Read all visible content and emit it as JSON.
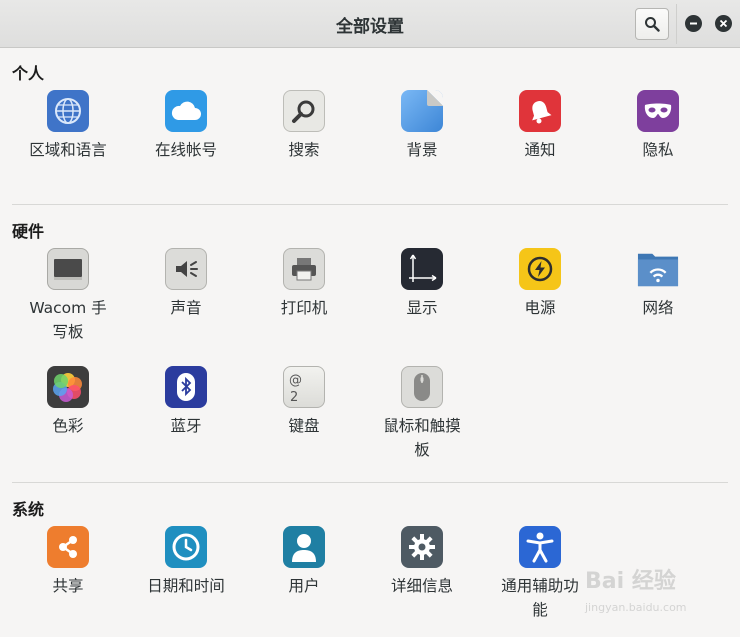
{
  "window": {
    "title": "全部设置"
  },
  "sections": {
    "personal": {
      "title": "个人",
      "items": [
        {
          "label": "区域和语言"
        },
        {
          "label": "在线帐号"
        },
        {
          "label": "搜索"
        },
        {
          "label": "背景"
        },
        {
          "label": "通知"
        },
        {
          "label": "隐私"
        }
      ]
    },
    "hardware": {
      "title": "硬件",
      "items": [
        {
          "label": "Wacom 手写板"
        },
        {
          "label": "声音"
        },
        {
          "label": "打印机"
        },
        {
          "label": "显示"
        },
        {
          "label": "电源"
        },
        {
          "label": "网络"
        },
        {
          "label": "色彩"
        },
        {
          "label": "蓝牙"
        },
        {
          "label": "键盘"
        },
        {
          "label": "鼠标和触摸板"
        }
      ]
    },
    "system": {
      "title": "系统",
      "items": [
        {
          "label": "共享"
        },
        {
          "label": "日期和时间"
        },
        {
          "label": "用户"
        },
        {
          "label": "详细信息"
        },
        {
          "label": "通用辅助功能"
        }
      ]
    }
  },
  "watermark": {
    "text": "Bai 经验",
    "sub": "jingyan.baidu.com"
  },
  "colors": {
    "region": "#3f74c8",
    "online": "#2f9ae6",
    "search": "#e8e8e4",
    "background": "#5aa0e6",
    "notifications": "#e0343a",
    "privacy": "#7e3f9d",
    "sound": "#dcdcd9",
    "power": "#f5c518",
    "network": "#5b8fc9",
    "bluetooth": "#2b3c9e",
    "sharing": "#ee7d2e",
    "datetime": "#1f8fc0",
    "users": "#1f7fa3",
    "details": "#4e5a63",
    "accessibility": "#2b67d4"
  }
}
